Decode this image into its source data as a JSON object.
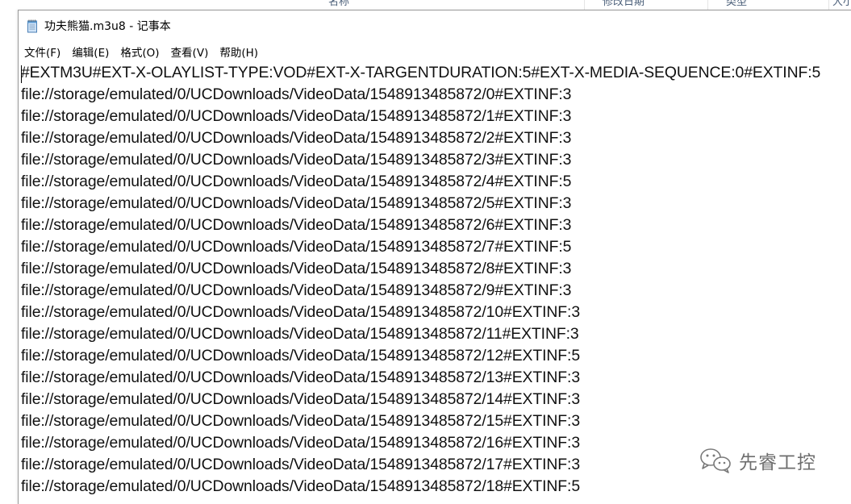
{
  "background_window": {
    "columns": [
      "名称",
      "修改日期",
      "类型",
      "大小"
    ]
  },
  "window": {
    "title": "功夫熊猫.m3u8 - 记事本",
    "icon": "notepad-icon"
  },
  "menu": {
    "items": [
      "文件(F)",
      "编辑(E)",
      "格式(O)",
      "查看(V)",
      "帮助(H)"
    ]
  },
  "editor": {
    "lines": [
      "#EXTM3U#EXT-X-OLAYLIST-TYPE:VOD#EXT-X-TARGENTDURATION:5#EXT-X-MEDIA-SEQUENCE:0#EXTINF:5",
      "file://storage/emulated/0/UCDownloads/VideoData/1548913485872/0#EXTINF:3",
      "file://storage/emulated/0/UCDownloads/VideoData/1548913485872/1#EXTINF:3",
      "file://storage/emulated/0/UCDownloads/VideoData/1548913485872/2#EXTINF:3",
      "file://storage/emulated/0/UCDownloads/VideoData/1548913485872/3#EXTINF:3",
      "file://storage/emulated/0/UCDownloads/VideoData/1548913485872/4#EXTINF:5",
      "file://storage/emulated/0/UCDownloads/VideoData/1548913485872/5#EXTINF:3",
      "file://storage/emulated/0/UCDownloads/VideoData/1548913485872/6#EXTINF:3",
      "file://storage/emulated/0/UCDownloads/VideoData/1548913485872/7#EXTINF:5",
      "file://storage/emulated/0/UCDownloads/VideoData/1548913485872/8#EXTINF:3",
      "file://storage/emulated/0/UCDownloads/VideoData/1548913485872/9#EXTINF:3",
      "file://storage/emulated/0/UCDownloads/VideoData/1548913485872/10#EXTINF:3",
      "file://storage/emulated/0/UCDownloads/VideoData/1548913485872/11#EXTINF:3",
      "file://storage/emulated/0/UCDownloads/VideoData/1548913485872/12#EXTINF:5",
      "file://storage/emulated/0/UCDownloads/VideoData/1548913485872/13#EXTINF:3",
      "file://storage/emulated/0/UCDownloads/VideoData/1548913485872/14#EXTINF:3",
      "file://storage/emulated/0/UCDownloads/VideoData/1548913485872/15#EXTINF:3",
      "file://storage/emulated/0/UCDownloads/VideoData/1548913485872/16#EXTINF:3",
      "file://storage/emulated/0/UCDownloads/VideoData/1548913485872/17#EXTINF:3",
      "file://storage/emulated/0/UCDownloads/VideoData/1548913485872/18#EXTINF:5"
    ]
  },
  "watermark": {
    "text": "先睿工控",
    "icon": "wechat-icon"
  },
  "colors": {
    "text": "#111111",
    "watermark": "#6e6e6e",
    "window_border": "#9a9a9a"
  }
}
